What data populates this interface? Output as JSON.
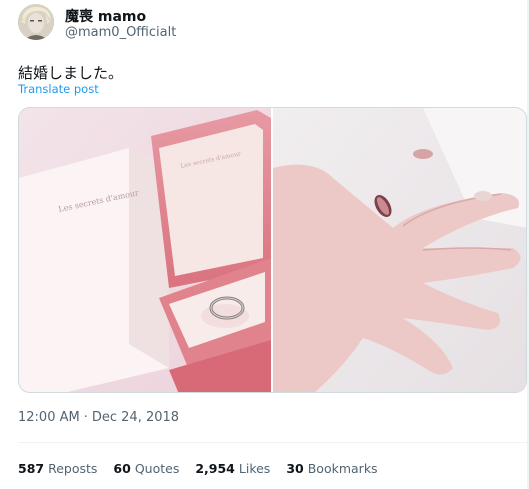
{
  "author": {
    "display_name": "魔喪 mamo",
    "handle": "@mam0_Officialt"
  },
  "tweet": {
    "text": "結婚しました。",
    "translate_label": "Translate post"
  },
  "media": {
    "ring_box_text": "Les secrets d'amour"
  },
  "meta": {
    "time": "12:00 AM",
    "separator": "·",
    "date": "Dec 24, 2018"
  },
  "stats": {
    "reposts_count": "587",
    "reposts_label": "Reposts",
    "quotes_count": "60",
    "quotes_label": "Quotes",
    "likes_count": "2,954",
    "likes_label": "Likes",
    "bookmarks_count": "30",
    "bookmarks_label": "Bookmarks"
  },
  "colors": {
    "link": "#1d9bf0",
    "secondary_text": "#536471",
    "primary_text": "#0f1419",
    "border": "#cfd9de"
  }
}
